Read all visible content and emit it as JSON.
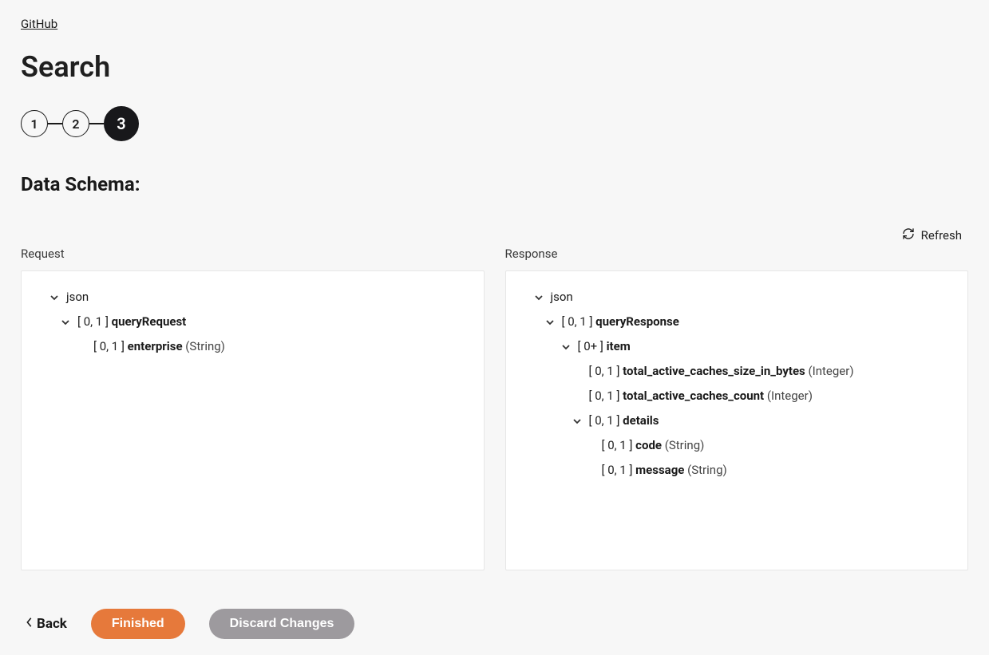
{
  "breadcrumb": {
    "label": "GitHub"
  },
  "page_title": "Search",
  "stepper": {
    "items": [
      "1",
      "2",
      "3"
    ],
    "active_index": 2
  },
  "section_title": "Data Schema:",
  "refresh_label": "Refresh",
  "panels": {
    "request": {
      "label": "Request",
      "root": "json",
      "rows": [
        {
          "cardinality": "[ 0, 1 ]",
          "name": "queryRequest",
          "type": "",
          "chev": true,
          "indent": 1
        },
        {
          "cardinality": "[ 0, 1 ]",
          "name": "enterprise",
          "type": "(String)",
          "chev": false,
          "indent": 2
        }
      ]
    },
    "response": {
      "label": "Response",
      "root": "json",
      "rows": [
        {
          "cardinality": "[ 0, 1 ]",
          "name": "queryResponse",
          "type": "",
          "chev": true,
          "indent": 1
        },
        {
          "cardinality": "[ 0+ ]",
          "name": "item",
          "type": "",
          "chev": true,
          "indent": 2
        },
        {
          "cardinality": "[ 0, 1 ]",
          "name": "total_active_caches_size_in_bytes",
          "type": "(Integer)",
          "chev": false,
          "indent": 3
        },
        {
          "cardinality": "[ 0, 1 ]",
          "name": "total_active_caches_count",
          "type": "(Integer)",
          "chev": false,
          "indent": 3
        },
        {
          "cardinality": "[ 0, 1 ]",
          "name": "details",
          "type": "",
          "chev": true,
          "indent": 3
        },
        {
          "cardinality": "[ 0, 1 ]",
          "name": "code",
          "type": "(String)",
          "chev": false,
          "indent": 4
        },
        {
          "cardinality": "[ 0, 1 ]",
          "name": "message",
          "type": "(String)",
          "chev": false,
          "indent": 4
        }
      ]
    }
  },
  "footer": {
    "back": "Back",
    "finished": "Finished",
    "discard": "Discard Changes"
  }
}
